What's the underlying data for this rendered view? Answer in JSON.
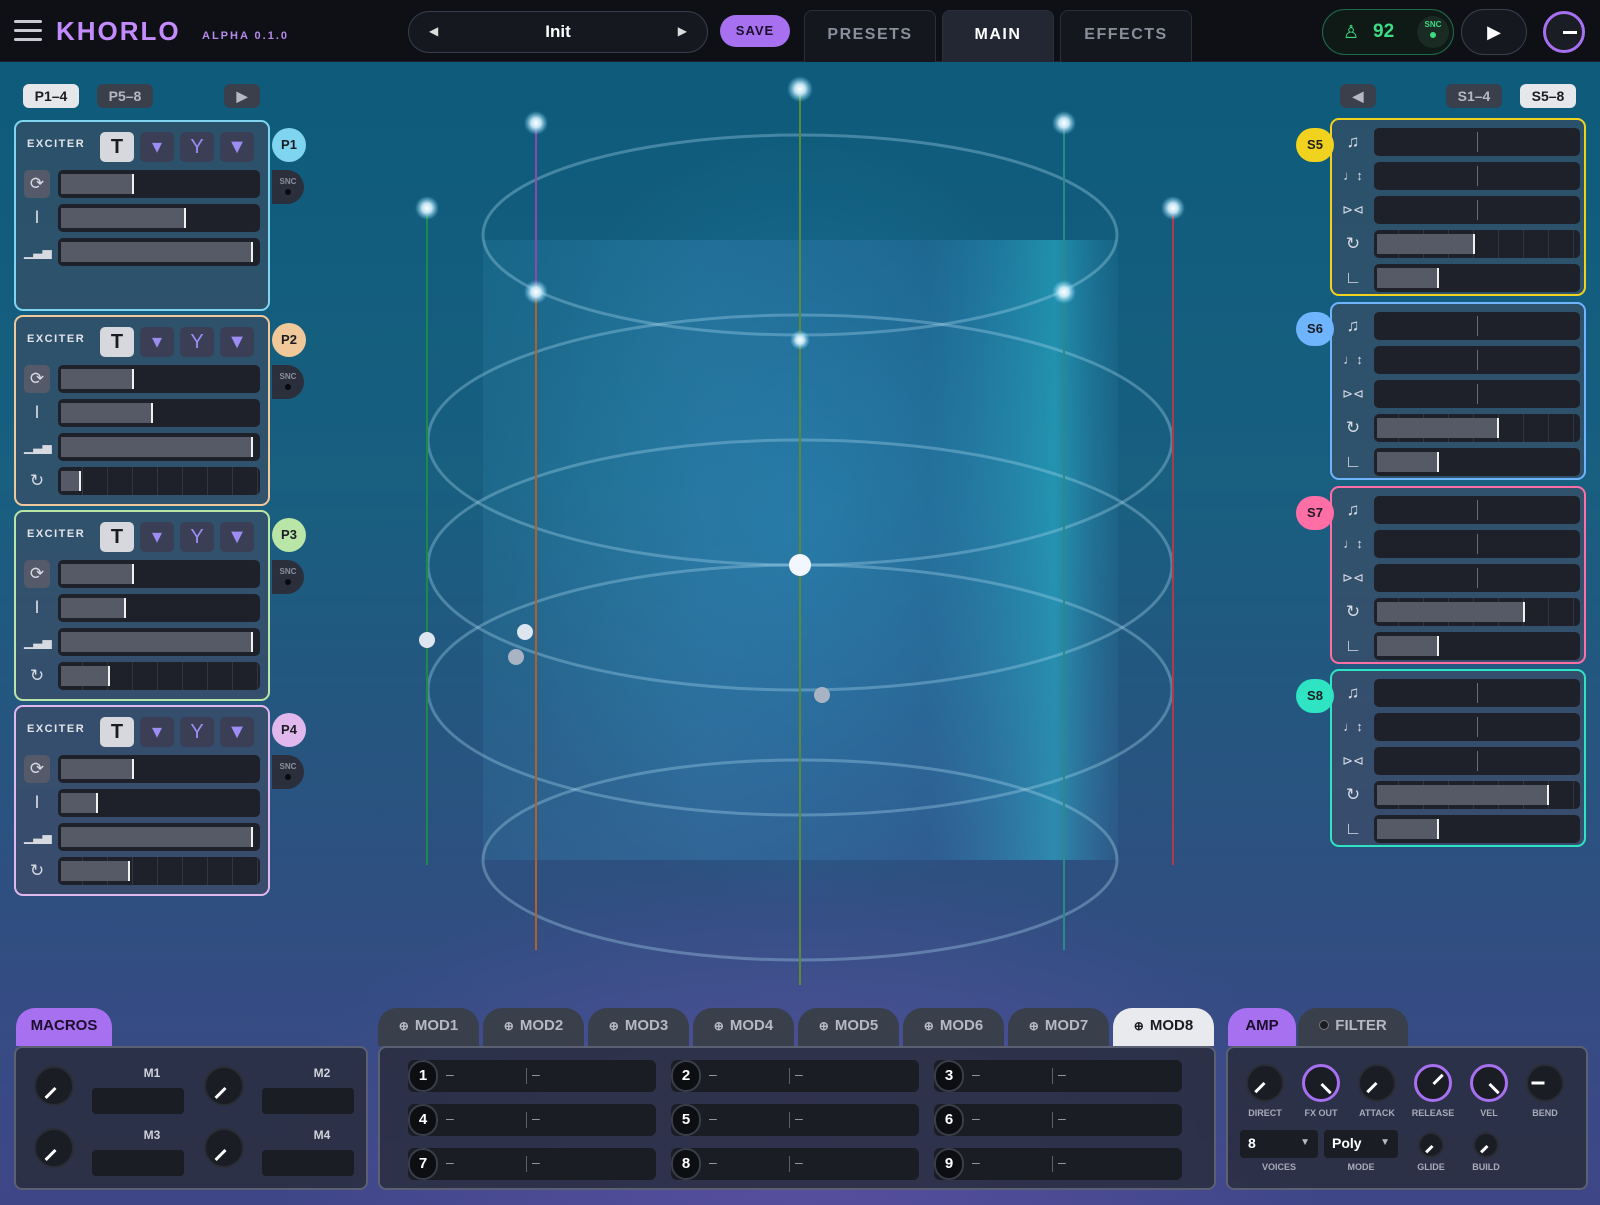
{
  "app": {
    "name": "KHORLO",
    "version": "ALPHA 0.1.0"
  },
  "preset": {
    "name": "Init",
    "prev": "◀",
    "next": "▶",
    "save_label": "SAVE"
  },
  "tabs": [
    {
      "label": "PRESETS"
    },
    {
      "label": "MAIN"
    },
    {
      "label": "EFFECTS"
    }
  ],
  "active_tab": "MAIN",
  "tempo": {
    "bpm": "92",
    "sync_label": "SNC"
  },
  "partial_pages": {
    "p1": "P1–4",
    "p2": "P5–8",
    "arrow": "▶"
  },
  "scanner_pages": {
    "arrow": "◀",
    "s1": "S1–4",
    "s2": "S5–8"
  },
  "partials": [
    {
      "tag": "P1",
      "label": "EXCITER",
      "sync": "SNC",
      "color": "#7fd4ef",
      "values": [
        0.37,
        0.64,
        0.98
      ]
    },
    {
      "tag": "P2",
      "label": "EXCITER",
      "sync": "SNC",
      "color": "#f0c89a",
      "values": [
        0.37,
        0.47,
        0.98,
        0.1
      ]
    },
    {
      "tag": "P3",
      "label": "EXCITER",
      "sync": "SNC",
      "color": "#b9e6a6",
      "values": [
        0.37,
        0.33,
        0.98,
        0.25
      ]
    },
    {
      "tag": "P4",
      "label": "EXCITER",
      "sync": "SNC",
      "color": "#e0b8ee",
      "values": [
        0.37,
        0.19,
        0.98,
        0.35
      ]
    }
  ],
  "scanners": [
    {
      "tag": "S5",
      "color": "#f1d21e",
      "values": [
        0.5,
        0.5,
        0.5,
        0.49,
        0.31
      ]
    },
    {
      "tag": "S6",
      "color": "#6fb4ff",
      "values": [
        0.5,
        0.5,
        0.5,
        0.61,
        0.31
      ]
    },
    {
      "tag": "S7",
      "color": "#ff6ea5",
      "values": [
        0.5,
        0.5,
        0.5,
        0.74,
        0.31
      ]
    },
    {
      "tag": "S8",
      "color": "#2ee4c2",
      "values": [
        0.5,
        0.5,
        0.5,
        0.86,
        0.31
      ]
    }
  ],
  "macros": {
    "tab": "MACROS",
    "labels": [
      "M1",
      "M2",
      "M3",
      "M4"
    ]
  },
  "mod_tabs": [
    "MOD1",
    "MOD2",
    "MOD3",
    "MOD4",
    "MOD5",
    "MOD6",
    "MOD7",
    "MOD8"
  ],
  "active_mod": "MOD8",
  "mod_slots": [
    {
      "num": "1",
      "a": "–",
      "b": "–"
    },
    {
      "num": "2",
      "a": "–",
      "b": "–"
    },
    {
      "num": "3",
      "a": "–",
      "b": "–"
    },
    {
      "num": "4",
      "a": "–",
      "b": "–"
    },
    {
      "num": "5",
      "a": "–",
      "b": "–"
    },
    {
      "num": "6",
      "a": "–",
      "b": "–"
    },
    {
      "num": "7",
      "a": "–",
      "b": "–"
    },
    {
      "num": "8",
      "a": "–",
      "b": "–"
    },
    {
      "num": "9",
      "a": "–",
      "b": "–"
    }
  ],
  "amp": {
    "tab": "AMP",
    "filter_tab": "FILTER",
    "knobs": [
      "DIRECT",
      "FX OUT",
      "ATTACK",
      "RELEASE",
      "VEL",
      "BEND"
    ],
    "voices_value": "8",
    "voices_label": "VOICES",
    "mode_value": "Poly",
    "mode_label": "MODE",
    "glide_label": "GLIDE",
    "build_label": "BUILD"
  }
}
